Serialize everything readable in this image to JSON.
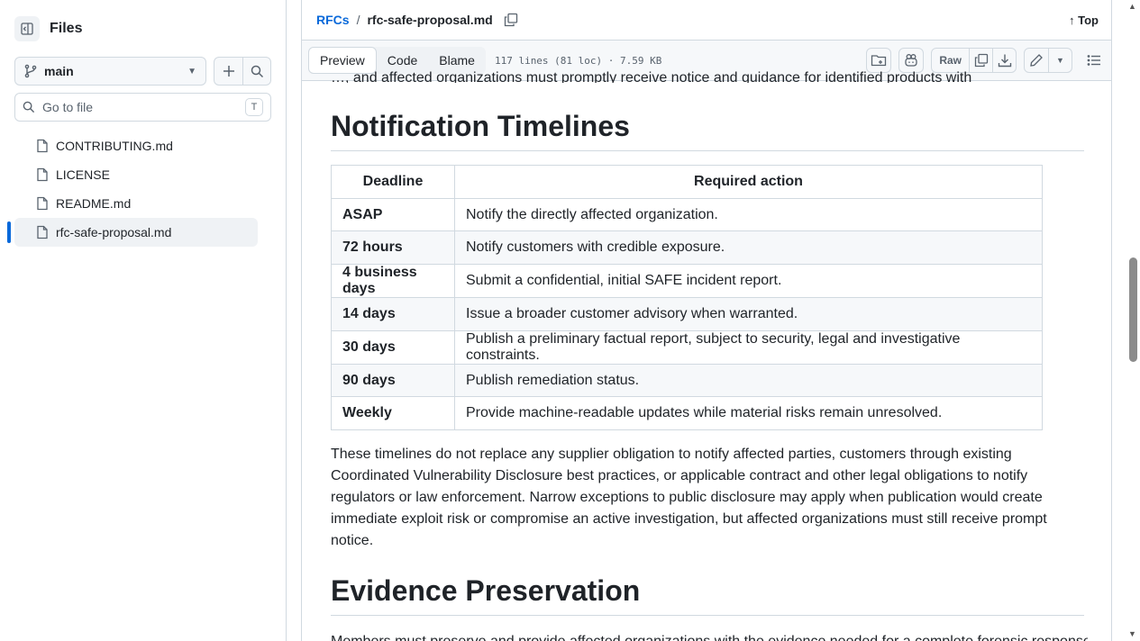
{
  "sidebar": {
    "title": "Files",
    "branch": "main",
    "goto_placeholder": "Go to file",
    "goto_shortcut": "T",
    "files": [
      {
        "name": "CONTRIBUTING.md"
      },
      {
        "name": "LICENSE"
      },
      {
        "name": "README.md"
      },
      {
        "name": "rfc-safe-proposal.md",
        "active": true
      }
    ]
  },
  "breadcrumb": {
    "parent": "RFCs",
    "separator": "/",
    "current": "rfc-safe-proposal.md",
    "top_link": "↑ Top"
  },
  "toolbar": {
    "tabs": [
      "Preview",
      "Code",
      "Blame"
    ],
    "active_tab": "Preview",
    "meta": "117 lines (81 loc) · 7.59 KB",
    "raw_label": "Raw"
  },
  "content": {
    "prev_line": "…, and affected organizations must promptly receive notice and guidance for identified products with exposure and mitigation.",
    "heading1": "Notification Timelines",
    "table": {
      "headers": [
        "Deadline",
        "Required action"
      ],
      "rows": [
        [
          "ASAP",
          "Notify the directly affected organization."
        ],
        [
          "72 hours",
          "Notify customers with credible exposure."
        ],
        [
          "4 business days",
          "Submit a confidential, initial SAFE incident report."
        ],
        [
          "14 days",
          "Issue a broader customer advisory when warranted."
        ],
        [
          "30 days",
          "Publish a preliminary factual report, subject to security, legal and investigative constraints."
        ],
        [
          "90 days",
          "Publish remediation status."
        ],
        [
          "Weekly",
          "Provide machine-readable updates while material risks remain unresolved."
        ]
      ]
    },
    "paragraph": "These timelines do not replace any supplier obligation to notify affected parties, customers through existing Coordinated Vulnerability Disclosure best practices, or applicable contract and other legal obligations to notify regulators or law enforcement. Narrow exceptions to public disclosure may apply when publication would create immediate exploit risk or compromise an active investigation, but affected organizations must still receive prompt notice.",
    "heading2": "Evidence Preservation",
    "next_line": "Members must preserve and provide affected organizations with the evidence needed for a complete forensic response."
  }
}
